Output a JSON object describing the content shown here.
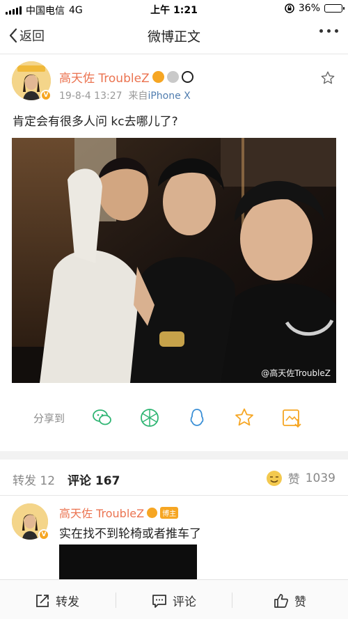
{
  "status_bar": {
    "carrier": "中国电信",
    "network": "4G",
    "time": "上午 1:21",
    "battery": "36%",
    "battery_level": 0.36
  },
  "nav": {
    "back_label": "返回",
    "title": "微博正文"
  },
  "post": {
    "username": "高天佐 TroubleZ",
    "timestamp": "19-8-4 13:27",
    "source_prefix": "来自",
    "source": "iPhone X",
    "text": "肯定会有很多人问 kc去哪儿了?",
    "image_watermark": "@高天佐TroubleZ",
    "avatar_badge": "V"
  },
  "share": {
    "label": "分享到",
    "targets": [
      "wechat-icon",
      "moments-icon",
      "qq-icon",
      "favorite-star-icon",
      "save-image-icon"
    ]
  },
  "tabs": {
    "reposts_label": "转发",
    "reposts_count": "12",
    "comments_label": "评论",
    "comments_count": "167",
    "likes_label": "赞",
    "likes_count": "1039"
  },
  "comment": {
    "username": "高天佐 TroubleZ",
    "author_tag": "博主",
    "text": "实在找不到轮椅或者推车了"
  },
  "bottom_bar": {
    "repost": "转发",
    "comment": "评论",
    "like": "赞"
  },
  "colors": {
    "username": "#eb7350",
    "source_link": "#507daf",
    "accent_green": "#2fb573",
    "accent_blue": "#3a8fd6",
    "accent_orange": "#f6a623"
  }
}
